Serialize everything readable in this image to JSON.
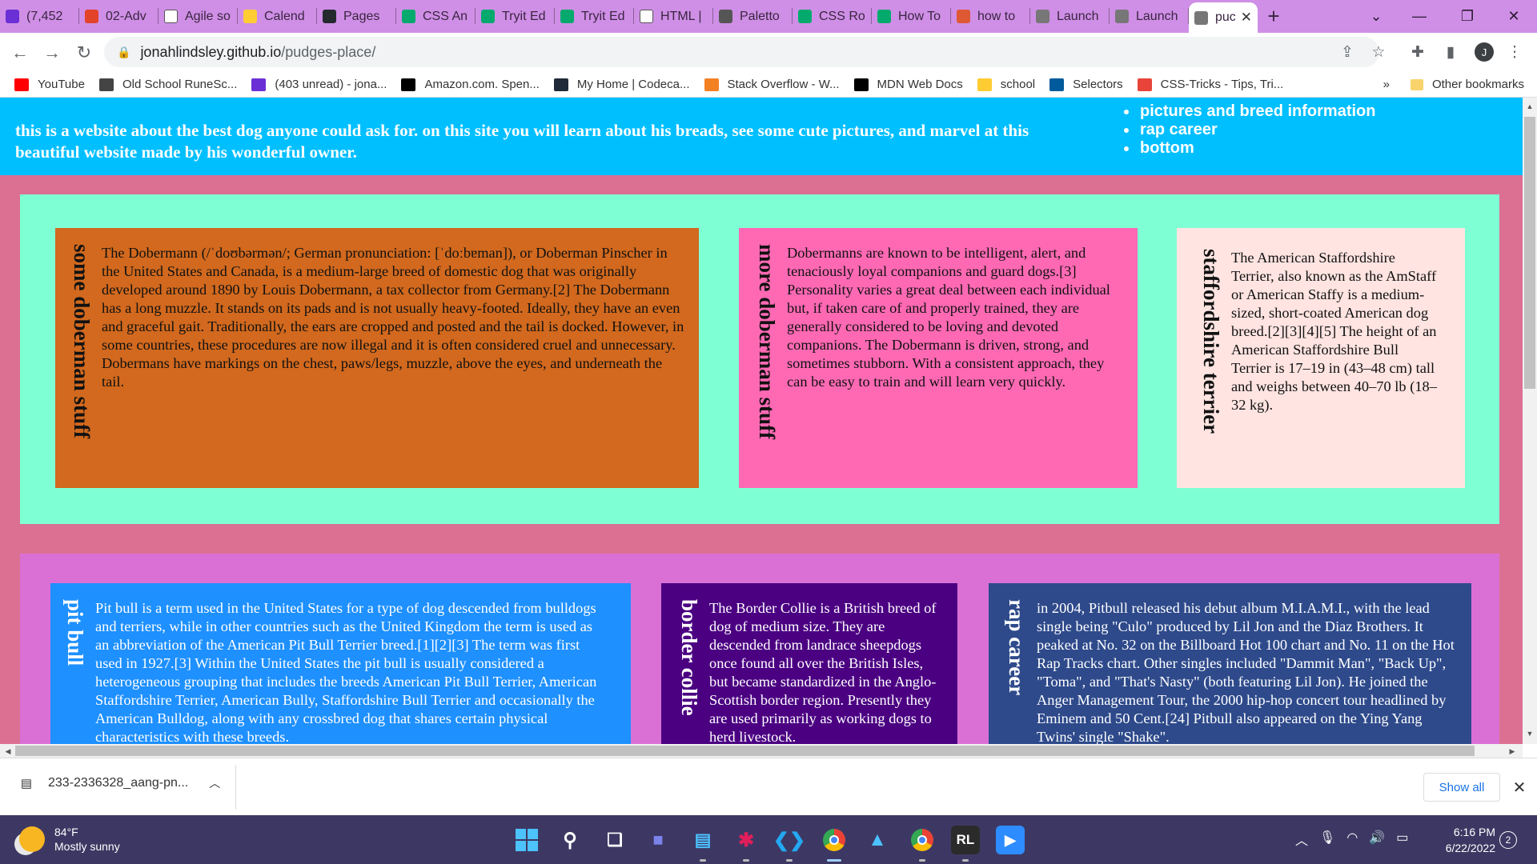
{
  "browser": {
    "tabs": [
      {
        "label": "(7,452",
        "icon": "mail-icon",
        "color": "#6b2fd6"
      },
      {
        "label": "02-Adv",
        "icon": "gitlab-icon",
        "color": "#e24329"
      },
      {
        "label": "Agile so",
        "icon": "wikipedia-icon",
        "color": "#ffffff"
      },
      {
        "label": "Calend",
        "icon": "umn-icon",
        "color": "#ffcc33"
      },
      {
        "label": "Pages",
        "icon": "github-icon",
        "color": "#24292e"
      },
      {
        "label": "CSS An",
        "icon": "w3schools-icon",
        "color": "#04aa6d"
      },
      {
        "label": "Tryit Ed",
        "icon": "w3schools-icon",
        "color": "#04aa6d"
      },
      {
        "label": "Tryit Ed",
        "icon": "w3schools-icon",
        "color": "#04aa6d"
      },
      {
        "label": "HTML |",
        "icon": "codecademy-icon",
        "color": "#ffffff"
      },
      {
        "label": "Paletto",
        "icon": "palette-icon",
        "color": "#555555"
      },
      {
        "label": "CSS Ro",
        "icon": "w3schools-icon",
        "color": "#04aa6d"
      },
      {
        "label": "How To",
        "icon": "w3schools-icon",
        "color": "#04aa6d"
      },
      {
        "label": "how to",
        "icon": "duckduckgo-icon",
        "color": "#de5833"
      },
      {
        "label": "Launch",
        "icon": "globe-icon",
        "color": "#777777"
      },
      {
        "label": "Launch",
        "icon": "globe-icon",
        "color": "#777777"
      },
      {
        "label": "puc",
        "icon": "globe-icon",
        "color": "#777777",
        "active": true
      }
    ],
    "new_tab_label": "+",
    "url_host": "jonahlindsley.github.io",
    "url_path": "/pudges-place/",
    "profile_initial": "J",
    "bookmarks": [
      {
        "label": "YouTube",
        "icon": "youtube-icon",
        "color": "#ff0000"
      },
      {
        "label": "Old School RuneSc...",
        "icon": "runescape-icon",
        "color": "#444444"
      },
      {
        "label": "(403 unread) - jona...",
        "icon": "mail-icon",
        "color": "#6b2fd6"
      },
      {
        "label": "Amazon.com. Spen...",
        "icon": "amazon-icon",
        "color": "#000000"
      },
      {
        "label": "My Home | Codeca...",
        "icon": "codecademy-icon",
        "color": "#1f2937"
      },
      {
        "label": "Stack Overflow - W...",
        "icon": "stackoverflow-icon",
        "color": "#f48024"
      },
      {
        "label": "MDN Web Docs",
        "icon": "mdn-icon",
        "color": "#000000"
      },
      {
        "label": "school",
        "icon": "umn-icon",
        "color": "#ffcc33"
      },
      {
        "label": "Selectors",
        "icon": "w3c-icon",
        "color": "#005a9c"
      },
      {
        "label": "CSS-Tricks - Tips, Tri...",
        "icon": "css-tricks-icon",
        "color": "#e8443a"
      }
    ],
    "bookmarks_overflow": "»",
    "other_bookmarks": "Other bookmarks"
  },
  "page": {
    "tagline": "this is a website about the best dog anyone could ask for. on this site you will learn about his breads, see some cute pictures, and marvel at this beautiful website made by his wonderful owner.",
    "nav": [
      "pictures and breed information",
      "rap career",
      "bottom"
    ],
    "row1": [
      {
        "title": "some doberman stuff",
        "bg": "#d2691e",
        "text": "The Dobermann (/ˈdoʊbərmən/; German pronunciation: [ˈdoːbɐman]), or Doberman Pinscher in the United States and Canada, is a medium-large breed of domestic dog that was originally developed around 1890 by Louis Dobermann, a tax collector from Germany.[2] The Dobermann has a long muzzle. It stands on its pads and is not usually heavy-footed. Ideally, they have an even and graceful gait. Traditionally, the ears are cropped and posted and the tail is docked. However, in some countries, these procedures are now illegal and it is often considered cruel and unnecessary. Dobermans have markings on the chest, paws/legs, muzzle, above the eyes, and underneath the tail."
      },
      {
        "title": "more doberman stuff",
        "bg": "#ff69b4",
        "text": "Dobermanns are known to be intelligent, alert, and tenaciously loyal companions and guard dogs.[3] Personality varies a great deal between each individual but, if taken care of and properly trained, they are generally considered to be loving and devoted companions. The Dobermann is driven, strong, and sometimes stubborn. With a consistent approach, they can be easy to train and will learn very quickly."
      },
      {
        "title": "staffordshire terrier",
        "bg": "#ffe4e1",
        "text": "The American Staffordshire Terrier, also known as the AmStaff or American Staffy is a medium-sized, short-coated American dog breed.[2][3][4][5] The height of an American Staffordshire Bull Terrier is 17–19 in (43–48 cm) tall and weighs between 40–70 lb (18–32 kg)."
      }
    ],
    "row2": [
      {
        "title": "pit bull",
        "bg": "#1e90ff",
        "text": "Pit bull is a term used in the United States for a type of dog descended from bulldogs and terriers, while in other countries such as the United Kingdom the term is used as an abbreviation of the American Pit Bull Terrier breed.[1][2][3] The term was first used in 1927.[3] Within the United States the pit bull is usually considered a heterogeneous grouping that includes the breeds American Pit Bull Terrier, American Staffordshire Terrier, American Bully, Staffordshire Bull Terrier and occasionally the American Bulldog, along with any crossbred dog that shares certain physical characteristics with these breeds."
      },
      {
        "title": "border collie",
        "bg": "#4b0082",
        "text": "The Border Collie is a British breed of dog of medium size. They are descended from landrace sheepdogs once found all over the British Isles, but became standardized in the Anglo-Scottish border region. Presently they are used primarily as working dogs to herd livestock."
      },
      {
        "title": "rap career",
        "bg": "#2e4a8b",
        "text": "in 2004, Pitbull released his debut album M.I.A.M.I., with the lead single being \"Culo\" produced by Lil Jon and the Diaz Brothers. It peaked at No. 32 on the Billboard Hot 100 chart and No. 11 on the Hot Rap Tracks chart. Other singles included \"Dammit Man\", \"Back Up\", \"Toma\", and \"That's Nasty\" (both featuring Lil Jon). He joined the Anger Management Tour, the 2000 hip-hop concert tour headlined by Eminem and 50 Cent.[24] Pitbull also appeared on the Ying Yang Twins' single \"Shake\"."
      }
    ]
  },
  "download": {
    "filename": "233-2336328_aang-pn...",
    "show_all": "Show all"
  },
  "taskbar": {
    "temperature": "84°F",
    "condition": "Mostly sunny",
    "time": "6:16 PM",
    "date": "6/22/2022",
    "notifications": "2"
  }
}
